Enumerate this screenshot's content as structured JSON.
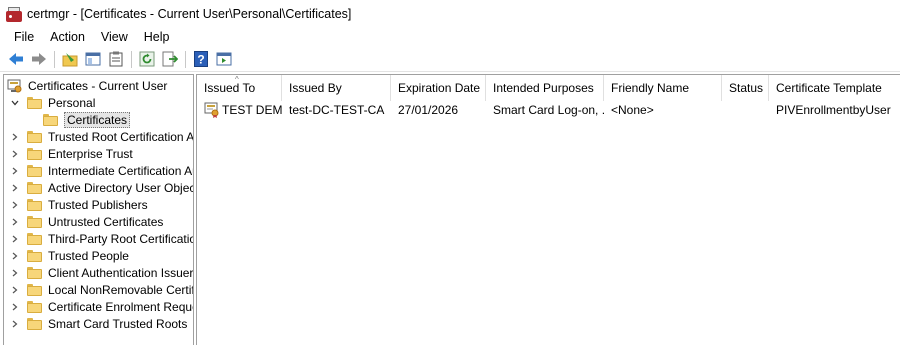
{
  "window": {
    "title": "certmgr - [Certificates - Current User\\Personal\\Certificates]"
  },
  "menu": [
    "File",
    "Action",
    "View",
    "Help"
  ],
  "toolbar": {
    "icons": [
      "back-arrow-icon",
      "forward-arrow-icon",
      "up-folder-icon",
      "show-hide-tree-icon",
      "properties-icon",
      "refresh-icon",
      "export-list-icon",
      "help-icon",
      "action-pane-icon"
    ]
  },
  "tree": {
    "root": "Certificates - Current User",
    "personal": "Personal",
    "certificates": "Certificates",
    "stores": [
      "Trusted Root Certification Aut",
      "Enterprise Trust",
      "Intermediate Certification Aut",
      "Active Directory User Object",
      "Trusted Publishers",
      "Untrusted Certificates",
      "Third-Party Root Certification",
      "Trusted People",
      "Client Authentication Issuers",
      "Local NonRemovable Certifica",
      "Certificate Enrolment Request",
      "Smart Card Trusted Roots"
    ]
  },
  "list": {
    "columns": [
      "Issued To",
      "Issued By",
      "Expiration Date",
      "Intended Purposes",
      "Friendly Name",
      "Status",
      "Certificate Template"
    ],
    "rows": [
      {
        "issued_to": "TEST DEMO",
        "issued_by": "test-DC-TEST-CA",
        "expiration": "27/01/2026",
        "purposes": "Smart Card Log-on, ...",
        "friendly": "<None>",
        "status": "",
        "template": "PIVEnrollmentbyUser"
      }
    ]
  },
  "colors": {
    "folder": "#f7d67a",
    "back_arrow": "#2f7fd4",
    "help_icon": "#2b5fb8",
    "app_icon": "#b3282d"
  }
}
